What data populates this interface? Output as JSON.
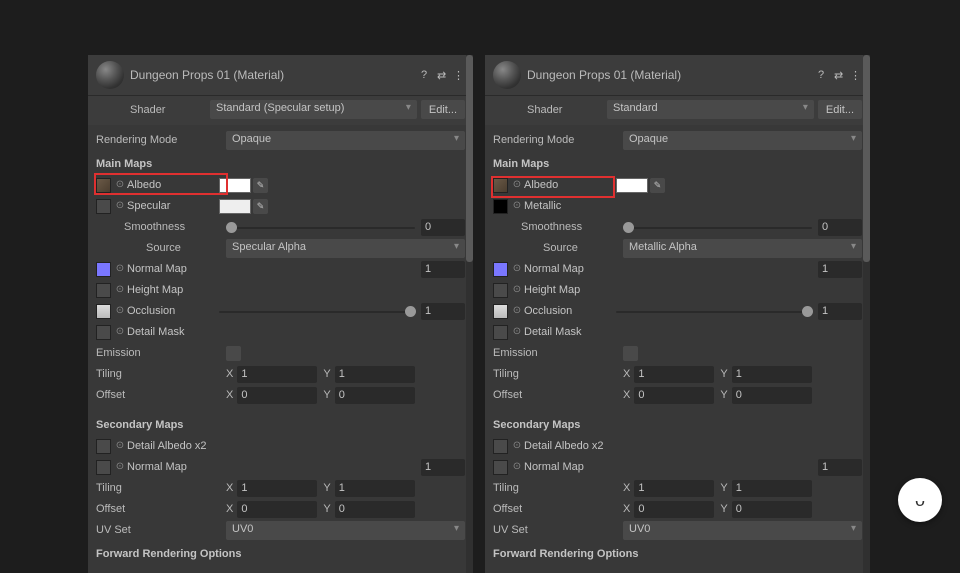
{
  "left": {
    "title": "Dungeon Props 01 (Material)",
    "shaderLabel": "Shader",
    "shader": "Standard (Specular setup)",
    "edit": "Edit...",
    "rmLabel": "Rendering Mode",
    "rm": "Opaque",
    "mainMaps": "Main Maps",
    "albedo": "Albedo",
    "albedoColor": "#ffffff",
    "specular": "Specular",
    "specColor": "#eeeeee",
    "smoothness": "Smoothness",
    "smoothVal": "0",
    "smoothPos": 0,
    "source": "Source",
    "sourceVal": "Specular Alpha",
    "normalMap": "Normal Map",
    "normalVal": "1",
    "normalSwatch": "#7a77ff",
    "heightMap": "Height Map",
    "occlusion": "Occlusion",
    "occVal": "1",
    "occPos": 95,
    "detailMask": "Detail Mask",
    "emission": "Emission",
    "tiling": "Tiling",
    "tilX": "1",
    "tilY": "1",
    "offset": "Offset",
    "offX": "0",
    "offY": "0",
    "secMaps": "Secondary Maps",
    "detailAlbedo": "Detail Albedo x2",
    "normalMap2": "Normal Map",
    "normal2Val": "1",
    "tiling2X": "1",
    "tiling2Y": "1",
    "offset2X": "0",
    "offset2Y": "0",
    "uvSet": "UV Set",
    "uvVal": "UV0",
    "fwd": "Forward Rendering Options"
  },
  "right": {
    "title": "Dungeon Props 01 (Material)",
    "shaderLabel": "Shader",
    "shader": "Standard",
    "edit": "Edit...",
    "rmLabel": "Rendering Mode",
    "rm": "Opaque",
    "mainMaps": "Main Maps",
    "albedo": "Albedo",
    "albedoColor": "#ffffff",
    "metallic": "Metallic",
    "metallicSwatch": "#000000",
    "smoothness": "Smoothness",
    "smoothVal": "0",
    "smoothPos": 0,
    "source": "Source",
    "sourceVal": "Metallic Alpha",
    "normalMap": "Normal Map",
    "normalVal": "1",
    "normalSwatch": "#7a77ff",
    "heightMap": "Height Map",
    "occlusion": "Occlusion",
    "occVal": "1",
    "occPos": 95,
    "detailMask": "Detail Mask",
    "emission": "Emission",
    "tiling": "Tiling",
    "tilX": "1",
    "tilY": "1",
    "offset": "Offset",
    "offX": "0",
    "offY": "0",
    "secMaps": "Secondary Maps",
    "detailAlbedo": "Detail Albedo x2",
    "normalMap2": "Normal Map",
    "normal2Val": "1",
    "tiling2X": "1",
    "tiling2Y": "1",
    "offset2X": "0",
    "offset2Y": "0",
    "uvSet": "UV Set",
    "uvVal": "UV0",
    "fwd": "Forward Rendering Options"
  },
  "xLabel": "X",
  "yLabel": "Y"
}
